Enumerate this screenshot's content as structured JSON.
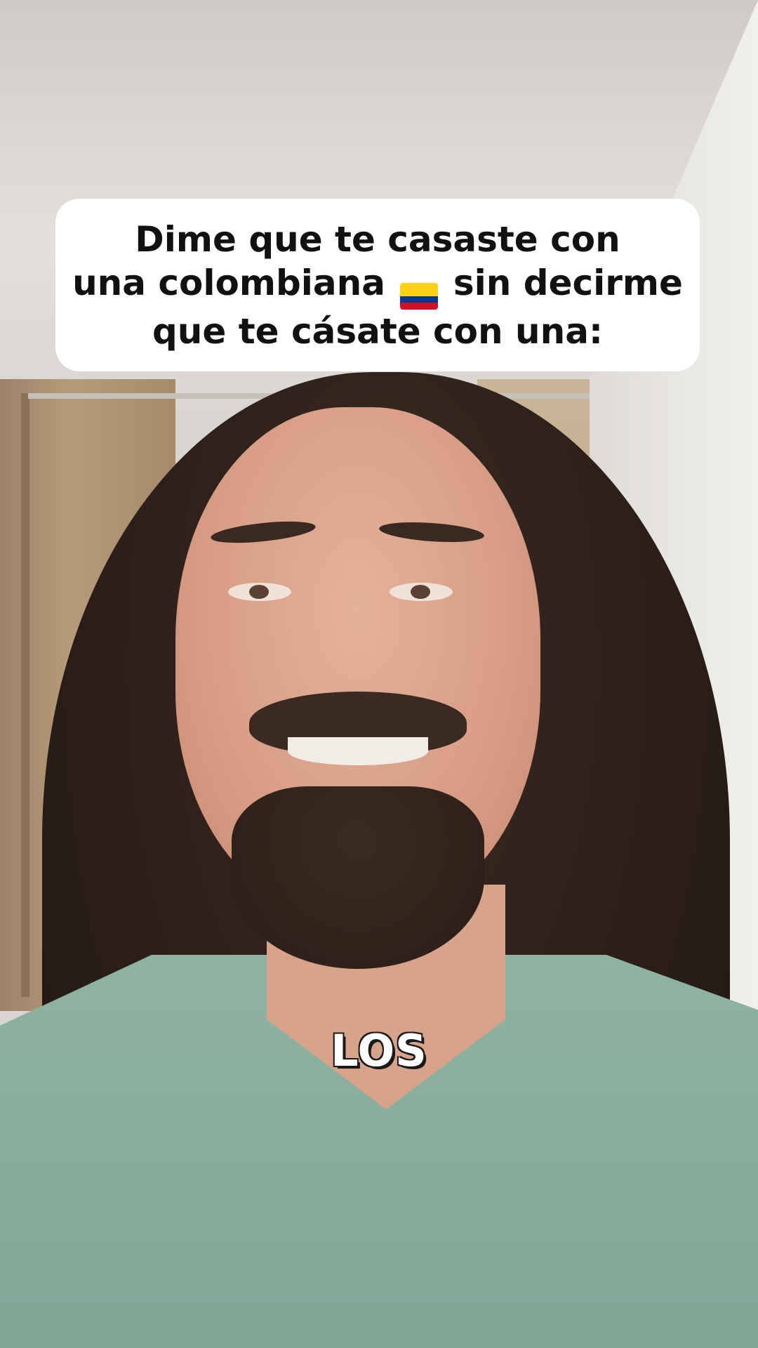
{
  "caption": {
    "line1": "Dime que te casaste con",
    "line2_before_flag": "una colombiana",
    "line2_after_flag": "sin decirme",
    "line3": "que te cásate con una:",
    "flag_icon": "colombia-flag-emoji",
    "flag_colors": [
      "#FCD116",
      "#003893",
      "#CE1126"
    ]
  },
  "subtitle": {
    "text": "LOS"
  }
}
